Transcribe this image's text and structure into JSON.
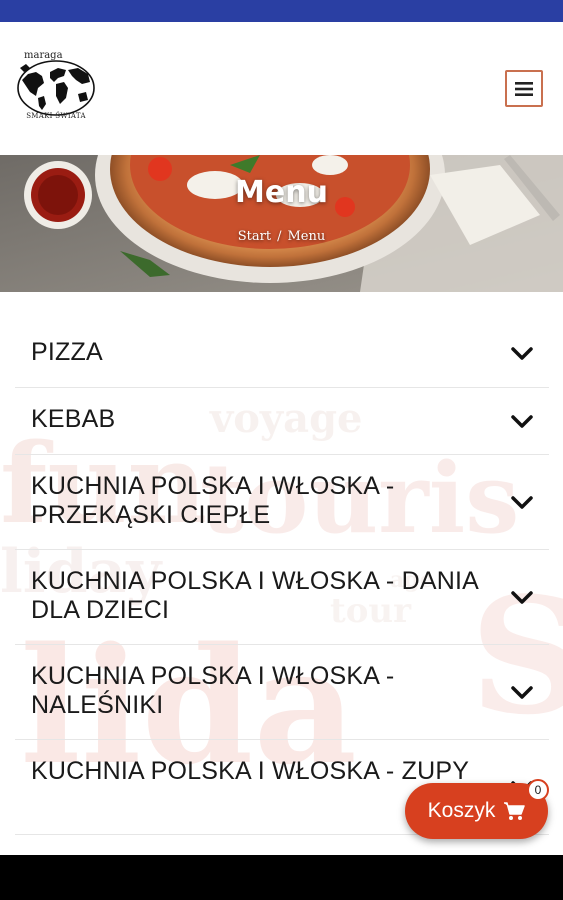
{
  "logo": {
    "brand": "maraga",
    "subtitle": "SMAKI ŚWIATA"
  },
  "hero": {
    "title": "Menu",
    "breadcrumb": {
      "home": "Start",
      "separator": "/",
      "current": "Menu"
    }
  },
  "menu": {
    "categories": [
      {
        "label": "PIZZA"
      },
      {
        "label": "KEBAB"
      },
      {
        "label": "KUCHNIA POLSKA I WŁOSKA - PRZEKĄSKI CIEPŁE"
      },
      {
        "label": "KUCHNIA POLSKA I WŁOSKA - DANIA DLA DZIECI"
      },
      {
        "label": "KUCHNIA POLSKA I WŁOSKA - NALEŚNIKI"
      },
      {
        "label": "KUCHNIA POLSKA I WŁOSKA - ZUPY"
      }
    ]
  },
  "cart": {
    "label": "Koszyk",
    "count": "0"
  },
  "icons": {
    "menu": "hamburger-icon",
    "expand": "chevron-down-icon",
    "cart": "cart-icon",
    "logo": "globe-icon"
  },
  "colors": {
    "status_bar": "#2a3fa3",
    "accent": "#d7401f",
    "hamburger_border": "#c9704f"
  }
}
